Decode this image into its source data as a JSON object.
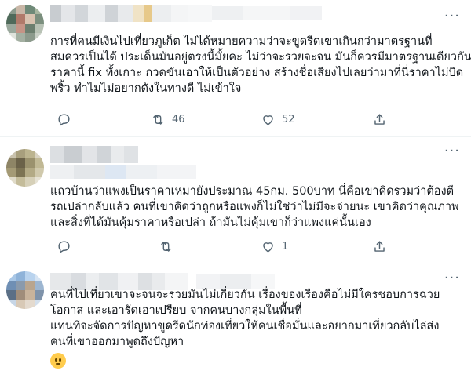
{
  "tweets": [
    {
      "lines": [
        "การที่คนมีเงินไปเที่ยวภูเก็ต ไม่ได้หมายความว่าจะขูดรีดเขาเกินกว่ามาตรฐานที่",
        "สมควรเป็นได้ ประเด็นมันอยู่ตรงนี้มั้ยคะ ไม่ว่าจะรวยจะจน มันก็ควรมีมาตรฐานเดียวกัน",
        "ราคานี้ fix ทั้งเกาะ กวดขันเอาให้เป็นตัวอย่าง สร้างชื่อเสียงไปเลยว่ามาที่นี่ราคาไม่บิด",
        "พริ้ว ทำไมไม่อยากดังในทางดี ไม่เข้าใจ"
      ],
      "reply_count": "",
      "retweet_count": "46",
      "like_count": "52"
    },
    {
      "lines": [
        "แถวบ้านว่าแพงเป็นราคาเหมายังประมาณ 45กม. 500บาท นี่คือเขาคิดรวมว่าต้องตี",
        "รถเปล่ากลับแล้ว คนที่เขาคิดว่าถูกหรือแพงก็ไม่ใช่ว่าไม่มีจะจ่ายนะ เขาคิดว่าคุณภาพ",
        "และสิ่งที่ได้มันคุ้มราคาหรือเปล่า ถ้ามันไม่คุ้มเขาก็ว่าแพงแค่นั้นเอง"
      ],
      "reply_count": "",
      "retweet_count": "",
      "like_count": "1"
    },
    {
      "lines": [
        "คนที่ไปเที่ยวเขาจะจนจะรวยมันไม่เกี่ยวกัน เรื่องของเรื่องคือไม่มีใครชอบการฉวย",
        "โอกาส และเอารัดเอาเปรียบ จากคนบางกลุ่มในพื้นที่",
        "แทนที่จะจัดการปัญหาขูดรีดนักท่องเที่ยวให้คนเชื่อมั่นและอยากมาเที่ยวกลับไล่ส่ง",
        "คนที่เขาออกมาพูดถึงปัญหา"
      ]
    }
  ],
  "colors": {
    "text": "#0f1419",
    "muted": "#536471",
    "border": "#eff3f4"
  },
  "icons": [
    "reply-icon",
    "retweet-icon",
    "like-icon",
    "share-icon",
    "more-icon",
    "confused-emoji"
  ]
}
